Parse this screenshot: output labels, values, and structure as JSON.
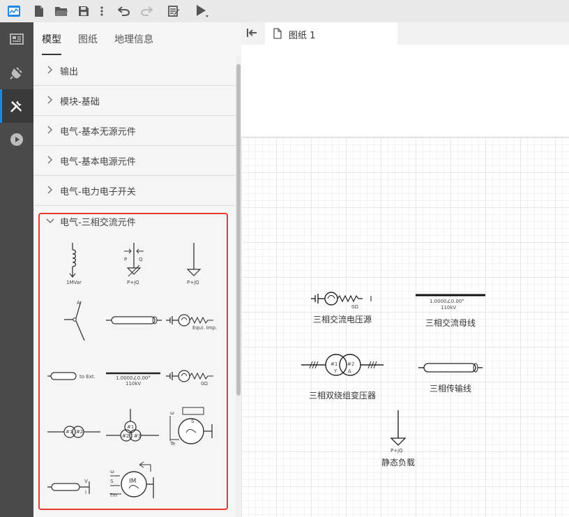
{
  "toolbar": {
    "icons": [
      "app-logo-icon",
      "new-file-icon",
      "open-folder-icon",
      "save-icon",
      "more-vert-icon",
      "undo-icon",
      "redo-icon",
      "edit-doc-icon",
      "run-icon"
    ]
  },
  "rail": {
    "items": [
      "dashboard-icon",
      "plugin-icon",
      "tools-icon",
      "play-icon"
    ],
    "active": "tools-icon"
  },
  "panel": {
    "tabs": [
      "模型",
      "图纸",
      "地理信息"
    ],
    "active_tab": "模型",
    "categories": [
      {
        "label": "输出",
        "expanded": false
      },
      {
        "label": "模块-基础",
        "expanded": false
      },
      {
        "label": "电气-基本无源元件",
        "expanded": false
      },
      {
        "label": "电气-基本电源元件",
        "expanded": false
      },
      {
        "label": "电气-电力电子开关",
        "expanded": false
      },
      {
        "label": "电气-三相交流元件",
        "expanded": true
      }
    ],
    "palette_labels": {
      "shunt_reactor": "1MVar",
      "pq_load_arrows_p": "P",
      "pq_load_arrows_q": "Q",
      "pq_load_arrows": "P+jQ",
      "static_load": "P+jQ",
      "fault_a": "A",
      "equiv_source": "Equi. Imp.",
      "to_ext": "to Ext.",
      "bus_value": "1.0000∠0.00°",
      "bus_kv": "110kV",
      "source_ohm": "0Ω",
      "xfmr_1": "#1",
      "xfmr_2": "#2",
      "xfmr3_1": "#1",
      "xfmr3_2": "#2",
      "xfmr3_3": "#3",
      "sm_w": "ω",
      "sm_s": "S",
      "sm_te": "Te",
      "sm_tm": "Tm",
      "im_w": "ω",
      "im_s": "S",
      "im_tm": "Tm",
      "im_label": "IM",
      "meter_v": "V",
      "meter_i": "I"
    }
  },
  "editor": {
    "tab_title": "图纸 1",
    "components": [
      {
        "label": "三相交流电压源",
        "value": "0Ω"
      },
      {
        "label": "三相交流母线",
        "value": "1.0000∠0.00°",
        "kv": "110kV"
      },
      {
        "label": "三相双绕组变压器",
        "w1": "#1",
        "w2": "#2",
        "y": "Y",
        "d": "Δ"
      },
      {
        "label": "三相传输线"
      },
      {
        "label": "静态负载",
        "pq": "P+jQ"
      }
    ]
  },
  "colors": {
    "toolbar_bg": "#e9e9e9",
    "rail_bg": "#4a4a4a",
    "rail_active_accent": "#1e88e5",
    "panel_bg": "#f5f5f5",
    "highlight": "#e53935"
  }
}
